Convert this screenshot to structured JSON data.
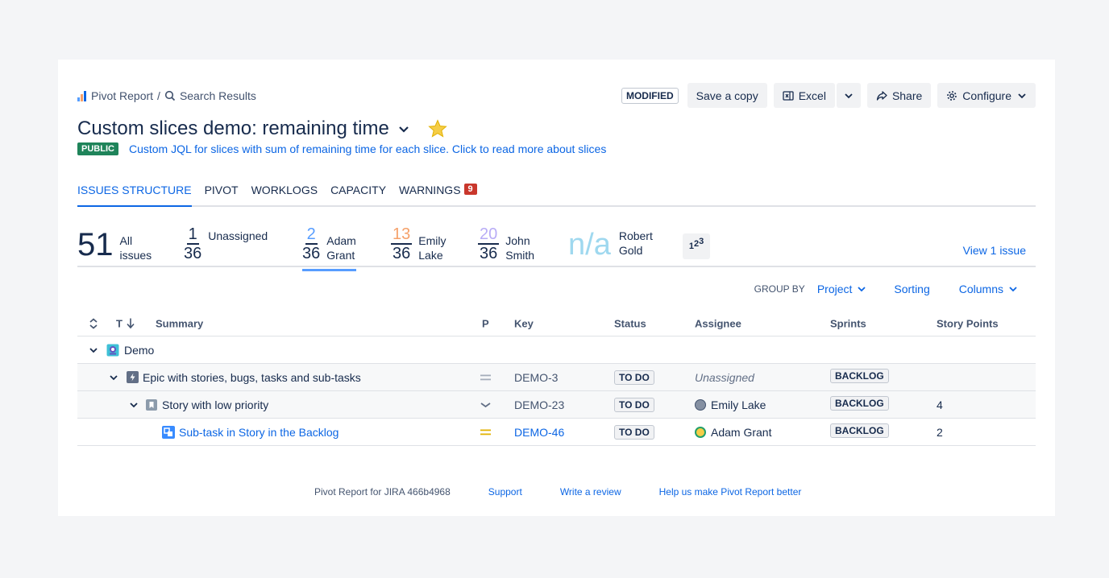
{
  "breadcrumb": {
    "root": "Pivot Report",
    "separator": "/",
    "current": "Search Results"
  },
  "toolbar": {
    "modified": "MODIFIED",
    "save_copy": "Save a copy",
    "excel": "Excel",
    "share": "Share",
    "configure": "Configure"
  },
  "report": {
    "title": "Custom slices demo: remaining time",
    "visibility": "PUBLIC",
    "description": "Custom JQL for slices with sum of remaining time for each slice. Click to read more about slices"
  },
  "tabs": [
    {
      "label": "ISSUES STRUCTURE",
      "active": true
    },
    {
      "label": "PIVOT"
    },
    {
      "label": "WORKLOGS"
    },
    {
      "label": "CAPACITY"
    },
    {
      "label": "WARNINGS",
      "badge": "9"
    }
  ],
  "slices": {
    "all": {
      "count": "51",
      "label1": "All",
      "label2": "issues"
    },
    "items": [
      {
        "num": "1",
        "den": "36",
        "label1": "Unassigned",
        "label2": "",
        "color": "#172b4d"
      },
      {
        "num": "2",
        "den": "36",
        "label1": "Adam",
        "label2": "Grant",
        "color": "#579dff",
        "active": true
      },
      {
        "num": "13",
        "den": "36",
        "label1": "Emily",
        "label2": "Lake",
        "color": "#f5a16a"
      },
      {
        "num": "20",
        "den": "36",
        "label1": "John",
        "label2": "Smith",
        "color": "#b8acf6"
      }
    ],
    "na": {
      "value": "n/a",
      "label1": "Robert",
      "label2": "Gold"
    },
    "numbers_icon": "123",
    "view_issue": "View 1 issue"
  },
  "group_bar": {
    "group_by": "GROUP BY",
    "project": "Project",
    "sorting": "Sorting",
    "columns": "Columns"
  },
  "table": {
    "headers": {
      "type": "T",
      "summary": "Summary",
      "priority": "P",
      "key": "Key",
      "status": "Status",
      "assignee": "Assignee",
      "sprints": "Sprints",
      "story_points": "Story Points"
    },
    "rows": [
      {
        "summary": "Demo",
        "icon": "project-icon"
      },
      {
        "summary": "Epic with stories, bugs, tasks and sub-tasks",
        "icon": "epic-icon",
        "priority": "medium",
        "key": "DEMO-3",
        "status": "TO DO",
        "assignee": "Unassigned",
        "sprint": "BACKLOG",
        "points": ""
      },
      {
        "summary": "Story with low priority",
        "icon": "story-icon",
        "priority": "low",
        "key": "DEMO-23",
        "status": "TO DO",
        "assignee": "Emily Lake",
        "sprint": "BACKLOG",
        "points": "4"
      },
      {
        "summary": "Sub-task in Story in the Backlog",
        "icon": "subtask-icon",
        "priority": "medium",
        "key": "DEMO-46",
        "status": "TO DO",
        "assignee": "Adam Grant",
        "sprint": "BACKLOG",
        "points": "2"
      }
    ]
  },
  "footer": {
    "version": "Pivot Report for JIRA 466b4968",
    "support": "Support",
    "review": "Write a review",
    "feedback": "Help us make Pivot Report better"
  },
  "colors": {
    "accent": "#0c66e4",
    "public": "#1f845a",
    "warning": "#c9372c",
    "star": "#f5cd47"
  }
}
